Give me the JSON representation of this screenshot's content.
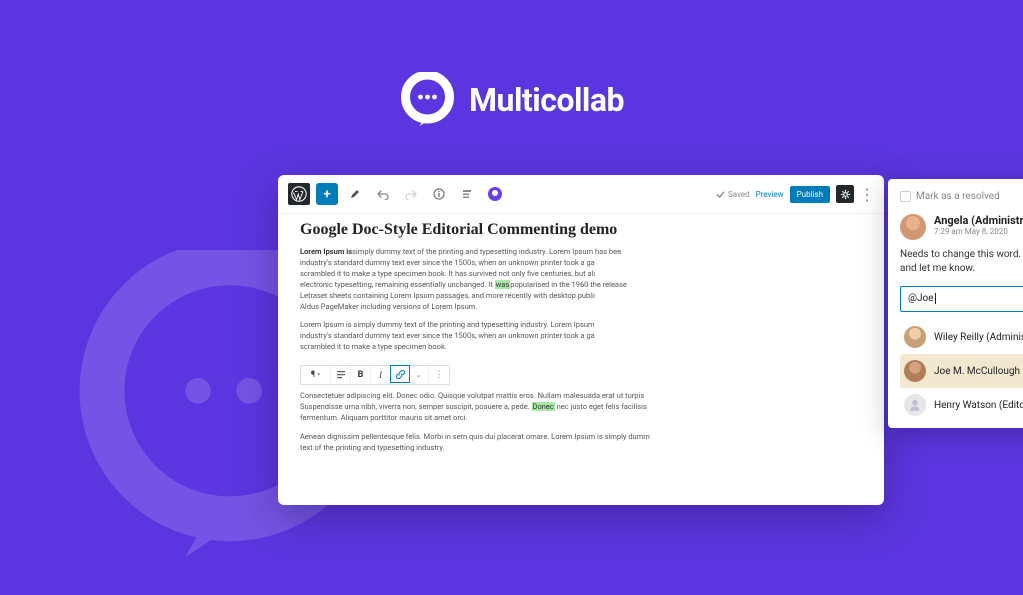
{
  "brand": {
    "name": "Multicollab"
  },
  "toolbar": {
    "saved": "Saved",
    "preview": "Preview",
    "publish": "Publish"
  },
  "document": {
    "title": "Google Doc-Style Editorial Commenting demo",
    "p1_lead": "Lorem Ipsum is",
    "p1a": " simply dummy text of the printing and typesetting industry. Lorem Ipsum has bee",
    "p1b": "industry's standard dummy text ever since the 1500s, when an unknown printer took a galley of type",
    "p1c": "scrambled it to make a type specimen book. It has survived not only five centuries, but also the leap",
    "p1d_before": "electronic typesetting, remaining essentially unchanged. It ",
    "p1d_hl": "was",
    "p1d_after": " popularised in the 1960 the release",
    "p1e": "Letraset sheets containing Lorem Ipsum passages, and more recently with desktop publishing soft",
    "p1f": "Aldus PageMaker including versions of Lorem Ipsum.",
    "p2a": "Lorem Ipsum is simply dummy text of the printing and typesetting industry. Lorem Ipsum has been",
    "p2b": "industry's standard dummy text ever since the 1500s, when an unknown printer took a galley of type",
    "p2c": "scrambled it to make a type specimen book.",
    "p3a": "Consectetuer adipiscing elit. Donec odio. Quisque volutpat mattis eros. Nullam malesuada erat ut turpis",
    "p3b_before": "Suspendisse urna nibh, viverra non, semper suscipit, posuere a, pede. ",
    "p3b_hl": "Donec",
    "p3b_after": " nec justo eget felis facilisis",
    "p3c": "fermentum. Aliquam porttitor mauris sit amet orci.",
    "p4a": "Aenean dignissim pellentesque felis. Morbi in sem quis dui placerat ornare. Lorem Ipsum is simply dumm",
    "p4b": "text of the printing and typesetting industry."
  },
  "comment": {
    "resolve_label": "Mark as a resolved",
    "author": "Angela (Administrator)",
    "timestamp": "7:29 am May 8, 2020",
    "body": "Needs to change this word. Kindly check and let me know.",
    "input_value": "@Joe",
    "mentions": [
      {
        "name": "Wiley Reilly (Administrator)"
      },
      {
        "name": "Joe M. McCullough (Editor)"
      },
      {
        "name": "Henry Watson (Editor)"
      }
    ]
  }
}
